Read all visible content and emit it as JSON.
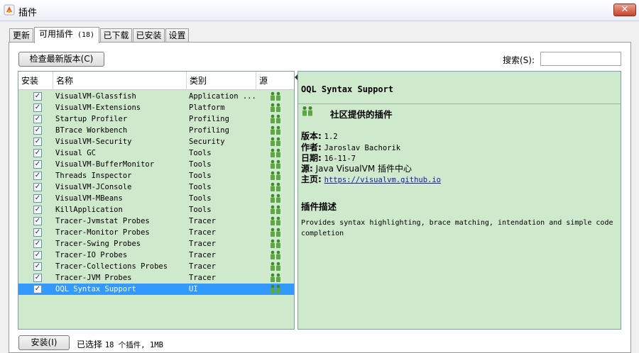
{
  "window": {
    "title": "插件",
    "close_symbol": "✕"
  },
  "tabs": [
    {
      "label": "更新"
    },
    {
      "label": "可用插件",
      "count": "(18)"
    },
    {
      "label": "已下载"
    },
    {
      "label": "已安装"
    },
    {
      "label": "设置"
    }
  ],
  "toolbar": {
    "check_latest_label": "检查最新版本(C)",
    "search_label": "搜索(S):",
    "search_value": ""
  },
  "table": {
    "columns": [
      "安装",
      "名称",
      "类别",
      "源"
    ],
    "rows": [
      {
        "name": "VisualVM-Glassfish",
        "category": "Application ...",
        "checked": true
      },
      {
        "name": "VisualVM-Extensions",
        "category": "Platform",
        "checked": true
      },
      {
        "name": "Startup Profiler",
        "category": "Profiling",
        "checked": true
      },
      {
        "name": "BTrace Workbench",
        "category": "Profiling",
        "checked": true
      },
      {
        "name": "VisualVM-Security",
        "category": "Security",
        "checked": true
      },
      {
        "name": "Visual GC",
        "category": "Tools",
        "checked": true
      },
      {
        "name": "VisualVM-BufferMonitor",
        "category": "Tools",
        "checked": true
      },
      {
        "name": "Threads Inspector",
        "category": "Tools",
        "checked": true
      },
      {
        "name": "VisualVM-JConsole",
        "category": "Tools",
        "checked": true
      },
      {
        "name": "VisualVM-MBeans",
        "category": "Tools",
        "checked": true
      },
      {
        "name": "KillApplication",
        "category": "Tools",
        "checked": true
      },
      {
        "name": "Tracer-Jvmstat Probes",
        "category": "Tracer",
        "checked": true
      },
      {
        "name": "Tracer-Monitor Probes",
        "category": "Tracer",
        "checked": true
      },
      {
        "name": "Tracer-Swing Probes",
        "category": "Tracer",
        "checked": true
      },
      {
        "name": "Tracer-IO Probes",
        "category": "Tracer",
        "checked": true
      },
      {
        "name": "Tracer-Collections Probes",
        "category": "Tracer",
        "checked": true
      },
      {
        "name": "Tracer-JVM Probes",
        "category": "Tracer",
        "checked": true
      },
      {
        "name": "OQL Syntax Support",
        "category": "UI",
        "checked": true,
        "selected": true
      }
    ],
    "check_symbol": "✓"
  },
  "details": {
    "title": "OQL Syntax Support",
    "community_label": "社区提供的插件",
    "version_key": "版本:",
    "version_value": "1.2",
    "author_key": "作者:",
    "author_value": "Jaroslav Bachorik",
    "date_key": "日期:",
    "date_value": "16-11-7",
    "source_key": "源:",
    "source_value": "Java VisualVM 插件中心",
    "homepage_key": "主页:",
    "homepage_value": "https://visualvm.github.io",
    "desc_heading": "插件描述",
    "desc_text": "Provides syntax highlighting, brace matching, intendation and simple code completion"
  },
  "footer": {
    "install_label": "安装(I)",
    "status_prefix": "已选择",
    "status_value": "18 个插件, 1MB"
  }
}
